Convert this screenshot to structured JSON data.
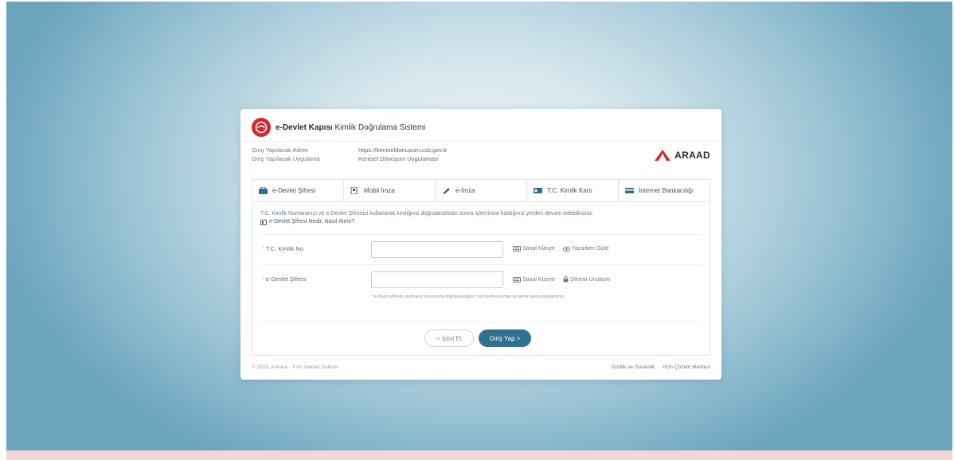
{
  "header": {
    "brand_bold": "e-Devlet Kapısı",
    "brand_rest": " Kimlik Doğrulama Sistemi"
  },
  "info": {
    "address_label": "Giriş Yapılacak Adres",
    "address_value": "https://kentseldonusum.csb.gov.tr",
    "app_label": "Giriş Yapılacak Uygulama",
    "app_value": "Kentsel Dönüşüm Uygulaması"
  },
  "partner_logo": {
    "text": "ARAAD",
    "color": "#d7262f"
  },
  "tabs": [
    {
      "label": "e-Devlet Şifresi",
      "icon": "key-card-icon",
      "active": true
    },
    {
      "label": "Mobil İmza",
      "icon": "mobile-signature-icon",
      "active": false
    },
    {
      "label": "e-İmza",
      "icon": "pen-signature-icon",
      "active": false
    },
    {
      "label": "T.C. Kimlik Kartı",
      "icon": "id-card-icon",
      "active": false
    },
    {
      "label": "İnternet Bankacılığı",
      "icon": "bank-card-icon",
      "active": false
    }
  ],
  "description": {
    "text": "T.C. Kimlik Numaranızı ve e-Devlet Şifrenizi kullanarak kimliğiniz doğrulandıktan sonra işleminize kaldığınız yerden devam edebilirsiniz.",
    "link": "e-Devlet Şifresi Nedir, Nasıl Alınır?"
  },
  "form": {
    "tc_label": "T.C. Kimlik No",
    "tc_value": "",
    "tc_virtual_keyboard": "Sanal Klavye",
    "tc_hide_while_typing": "Yazarken Gizle",
    "password_label": "e-Devlet Şifresi",
    "password_value": "",
    "password_virtual_keyboard": "Sanal Klavye",
    "forgot_password": "Şifremi Unuttum",
    "note": "* e-Devlet şifrenizi unutmanız durumunda doğrulayacağınız cep telefonunuzdan yenileme işlemi yapabilirsiniz."
  },
  "buttons": {
    "cancel": "< İptal Et",
    "login": "Giriş Yap >"
  },
  "footer": {
    "copyright": "© 2022, Ankara - Tüm Hakları Saklıdır.",
    "privacy": "Gizlilik ve Güvenlik",
    "help": "Hızlı Çözüm Merkezi"
  },
  "colors": {
    "primary_button": "#2f6f91",
    "brand_red": "#d7262f",
    "background": "#9ec5d6"
  }
}
